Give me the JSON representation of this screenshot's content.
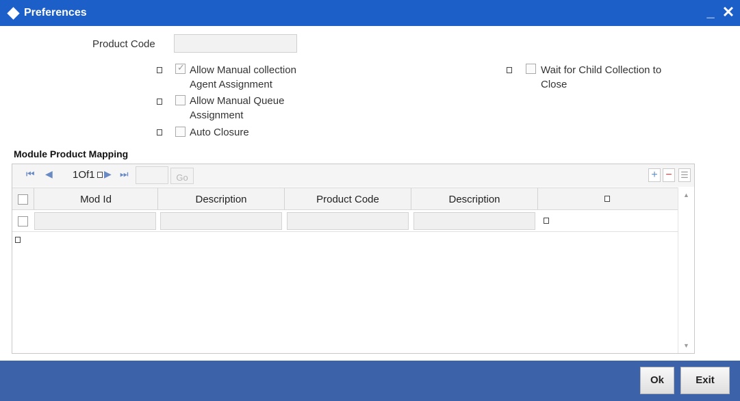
{
  "window": {
    "title": "Preferences",
    "minimize_glyph": "_",
    "close_glyph": "✕"
  },
  "form": {
    "product_code_label": "Product Code",
    "product_code_value": "",
    "options": [
      {
        "label_line1": "Allow Manual collection",
        "label_line2": "Agent Assignment",
        "checked": true
      },
      {
        "label_line1": "Allow Manual Queue",
        "label_line2": "Assignment",
        "checked": false
      },
      {
        "label_line1": "Auto Closure",
        "label_line2": "",
        "checked": false
      },
      {
        "label_line1": "Wait for Child Collection to",
        "label_line2": "Close",
        "checked": false
      }
    ]
  },
  "mapping": {
    "section_title": "Module Product Mapping",
    "pager": {
      "first_glyph": "⏮",
      "prev_glyph": "◀",
      "page_info": "1Of1",
      "next_glyph": "▶",
      "last_glyph": "⏭",
      "page_value": "",
      "go_label": "Go"
    },
    "columns": [
      "Mod Id",
      "Description",
      "Product Code",
      "Description"
    ],
    "rows": [
      {
        "mod_id": "",
        "description": "",
        "product_code": "",
        "product_description": ""
      }
    ]
  },
  "footer": {
    "ok_label": "Ok",
    "exit_label": "Exit"
  },
  "colors": {
    "titlebar": "#1d5fc9",
    "footer": "#3c63a9"
  },
  "icons": {
    "title": "diamond-icon",
    "add": "plus-icon",
    "delete": "minus-icon",
    "view": "list-icon"
  }
}
